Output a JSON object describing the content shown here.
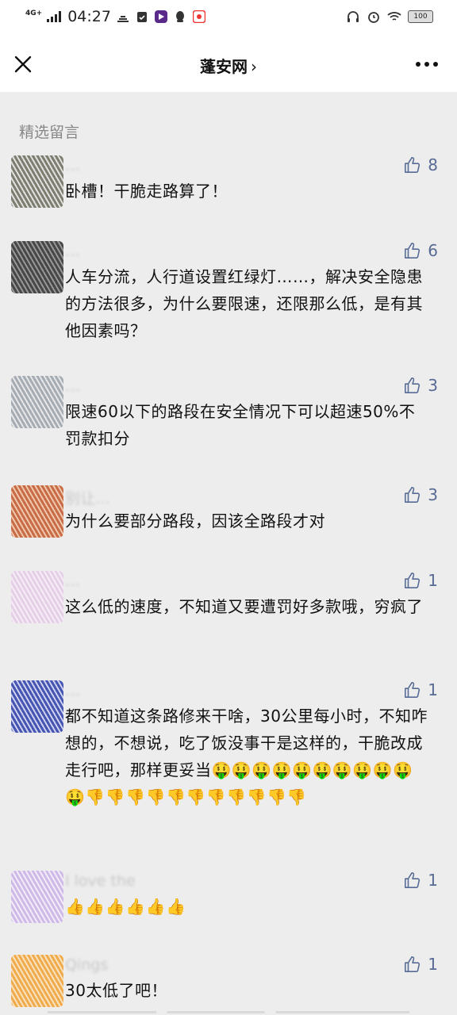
{
  "status_bar": {
    "network": "4G+",
    "time": "04:27",
    "battery": "100"
  },
  "header": {
    "title": "蓬安网",
    "chevron": "›"
  },
  "section": {
    "title": "精选留言"
  },
  "comments": [
    {
      "nickname": "…",
      "likes": "8",
      "text": "卧槽！干脆走路算了！",
      "avatar_color": "#6b6b5a"
    },
    {
      "nickname": "…",
      "likes": "6",
      "text": "人车分流，人行道设置红绿灯……，解决安全隐患的方法很多，为什么要限速，还限那么低，是有其他因素吗？",
      "avatar_color": "#2a2a2a"
    },
    {
      "nickname": "…",
      "likes": "3",
      "text": "限速60以下的路段在安全情况下可以超速50%不罚款扣分",
      "avatar_color": "#9aa0aa"
    },
    {
      "nickname": "别让…",
      "likes": "3",
      "text": "为什么要部分路段，因该全路段才对",
      "avatar_color": "#c0552a"
    },
    {
      "nickname": "…",
      "likes": "1",
      "text": "这么低的速度，不知道又要遭罚好多款哦，穷疯了",
      "avatar_color": "#e4c8e6"
    },
    {
      "nickname": "…",
      "likes": "1",
      "text": "都不知道这条路修来干啥，30公里每小时，不知咋想的，不想说，吃了饭没事干是这样的，干脆改成走行吧，那样更妥当🤑🤑🤑🤑🤑🤑🤑🤑🤑🤑🤑👎👎👎👎👎👎👎👎👎👎👎",
      "avatar_color": "#2a3aa8"
    },
    {
      "nickname": "I love the",
      "likes": "1",
      "text": "👍👍👍👍👍👍",
      "avatar_color": "#c9b0e6"
    },
    {
      "nickname": "Qings",
      "likes": "1",
      "text": "30太低了吧！",
      "avatar_color": "#f0a030"
    }
  ],
  "icons": {
    "close": "close-icon",
    "more": "more-icon",
    "like": "thumbs-up-icon"
  },
  "colors": {
    "like_blue": "#576b95",
    "background": "#ededed"
  }
}
